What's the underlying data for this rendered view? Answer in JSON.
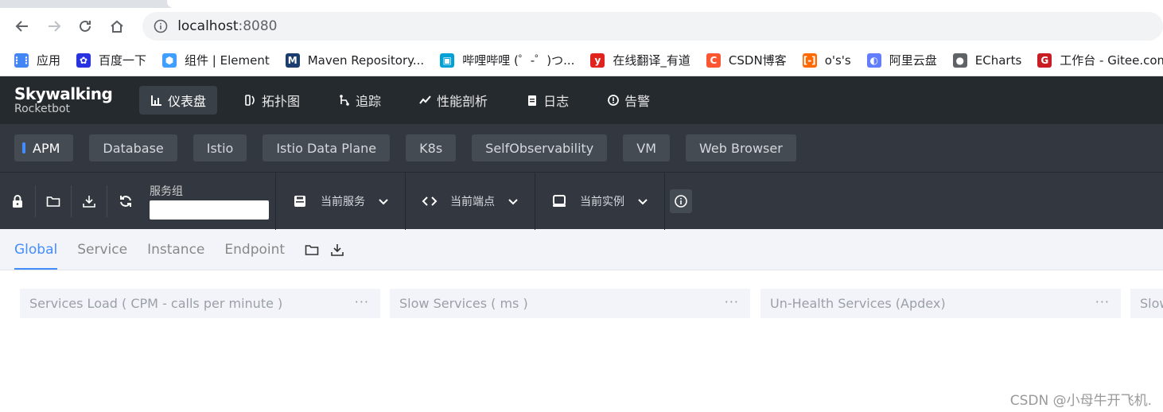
{
  "browser": {
    "url_host": "localhost",
    "url_port": ":8080",
    "bookmarks": [
      {
        "label": "应用",
        "icon": "apps-grid-icon",
        "color": "#4285f4"
      },
      {
        "label": "百度一下",
        "icon": "baidu-paw-icon",
        "color": "#2932e1"
      },
      {
        "label": "组件 | Element",
        "icon": "element-hex-icon",
        "color": "#409eff"
      },
      {
        "label": "Maven Repository...",
        "icon": "mvn-icon",
        "color": "#1a3c6e"
      },
      {
        "label": "哔哩哔哩 (゜-゜)つ...",
        "icon": "bilibili-tv-icon",
        "color": "#00a1d6"
      },
      {
        "label": "在线翻译_有道",
        "icon": "youdao-icon",
        "color": "#e0231d"
      },
      {
        "label": "CSDN博客",
        "icon": "csdn-icon",
        "color": "#fc5531"
      },
      {
        "label": "o's's",
        "icon": "aliyun-oss-icon",
        "color": "#ff6a00"
      },
      {
        "label": "阿里云盘",
        "icon": "aliyun-drive-icon",
        "color": "#637dff"
      },
      {
        "label": "ECharts",
        "icon": "globe-icon",
        "color": "#5f6368"
      },
      {
        "label": "工作台 - Gitee.com",
        "icon": "gitee-icon",
        "color": "#c71d23"
      }
    ]
  },
  "app": {
    "logo_line1": "Skywalking",
    "logo_line2": "Rocketbot",
    "topnav": [
      {
        "label": "仪表盘",
        "icon": "chart-icon",
        "active": true
      },
      {
        "label": "拓扑图",
        "icon": "topology-icon",
        "active": false
      },
      {
        "label": "追踪",
        "icon": "trace-icon",
        "active": false
      },
      {
        "label": "性能剖析",
        "icon": "profile-icon",
        "active": false
      },
      {
        "label": "日志",
        "icon": "log-icon",
        "active": false
      },
      {
        "label": "告警",
        "icon": "alarm-icon",
        "active": false
      }
    ],
    "groups": [
      "APM",
      "Database",
      "Istio",
      "Istio Data Plane",
      "K8s",
      "SelfObservability",
      "VM",
      "Web Browser"
    ],
    "toolbar": {
      "service_group_label": "服务组",
      "service_group_value": "",
      "current_service": "当前服务",
      "current_endpoint": "当前端点",
      "current_instance": "当前实例"
    },
    "tabs": [
      "Global",
      "Service",
      "Instance",
      "Endpoint"
    ],
    "panels": [
      {
        "title": "Services Load ( CPM - calls per minute )",
        "more": "···"
      },
      {
        "title": "Slow Services ( ms )",
        "more": "···"
      },
      {
        "title": "Un-Health Services (Apdex)",
        "more": "···"
      },
      {
        "title": "Slow",
        "more": ""
      }
    ],
    "watermark": "CSDN @小母牛开飞机."
  },
  "colors": {
    "header_bg": "#252a2f",
    "subheader_bg": "#333840",
    "accent": "#448dfe",
    "panel_bg": "#f3f4f9"
  }
}
